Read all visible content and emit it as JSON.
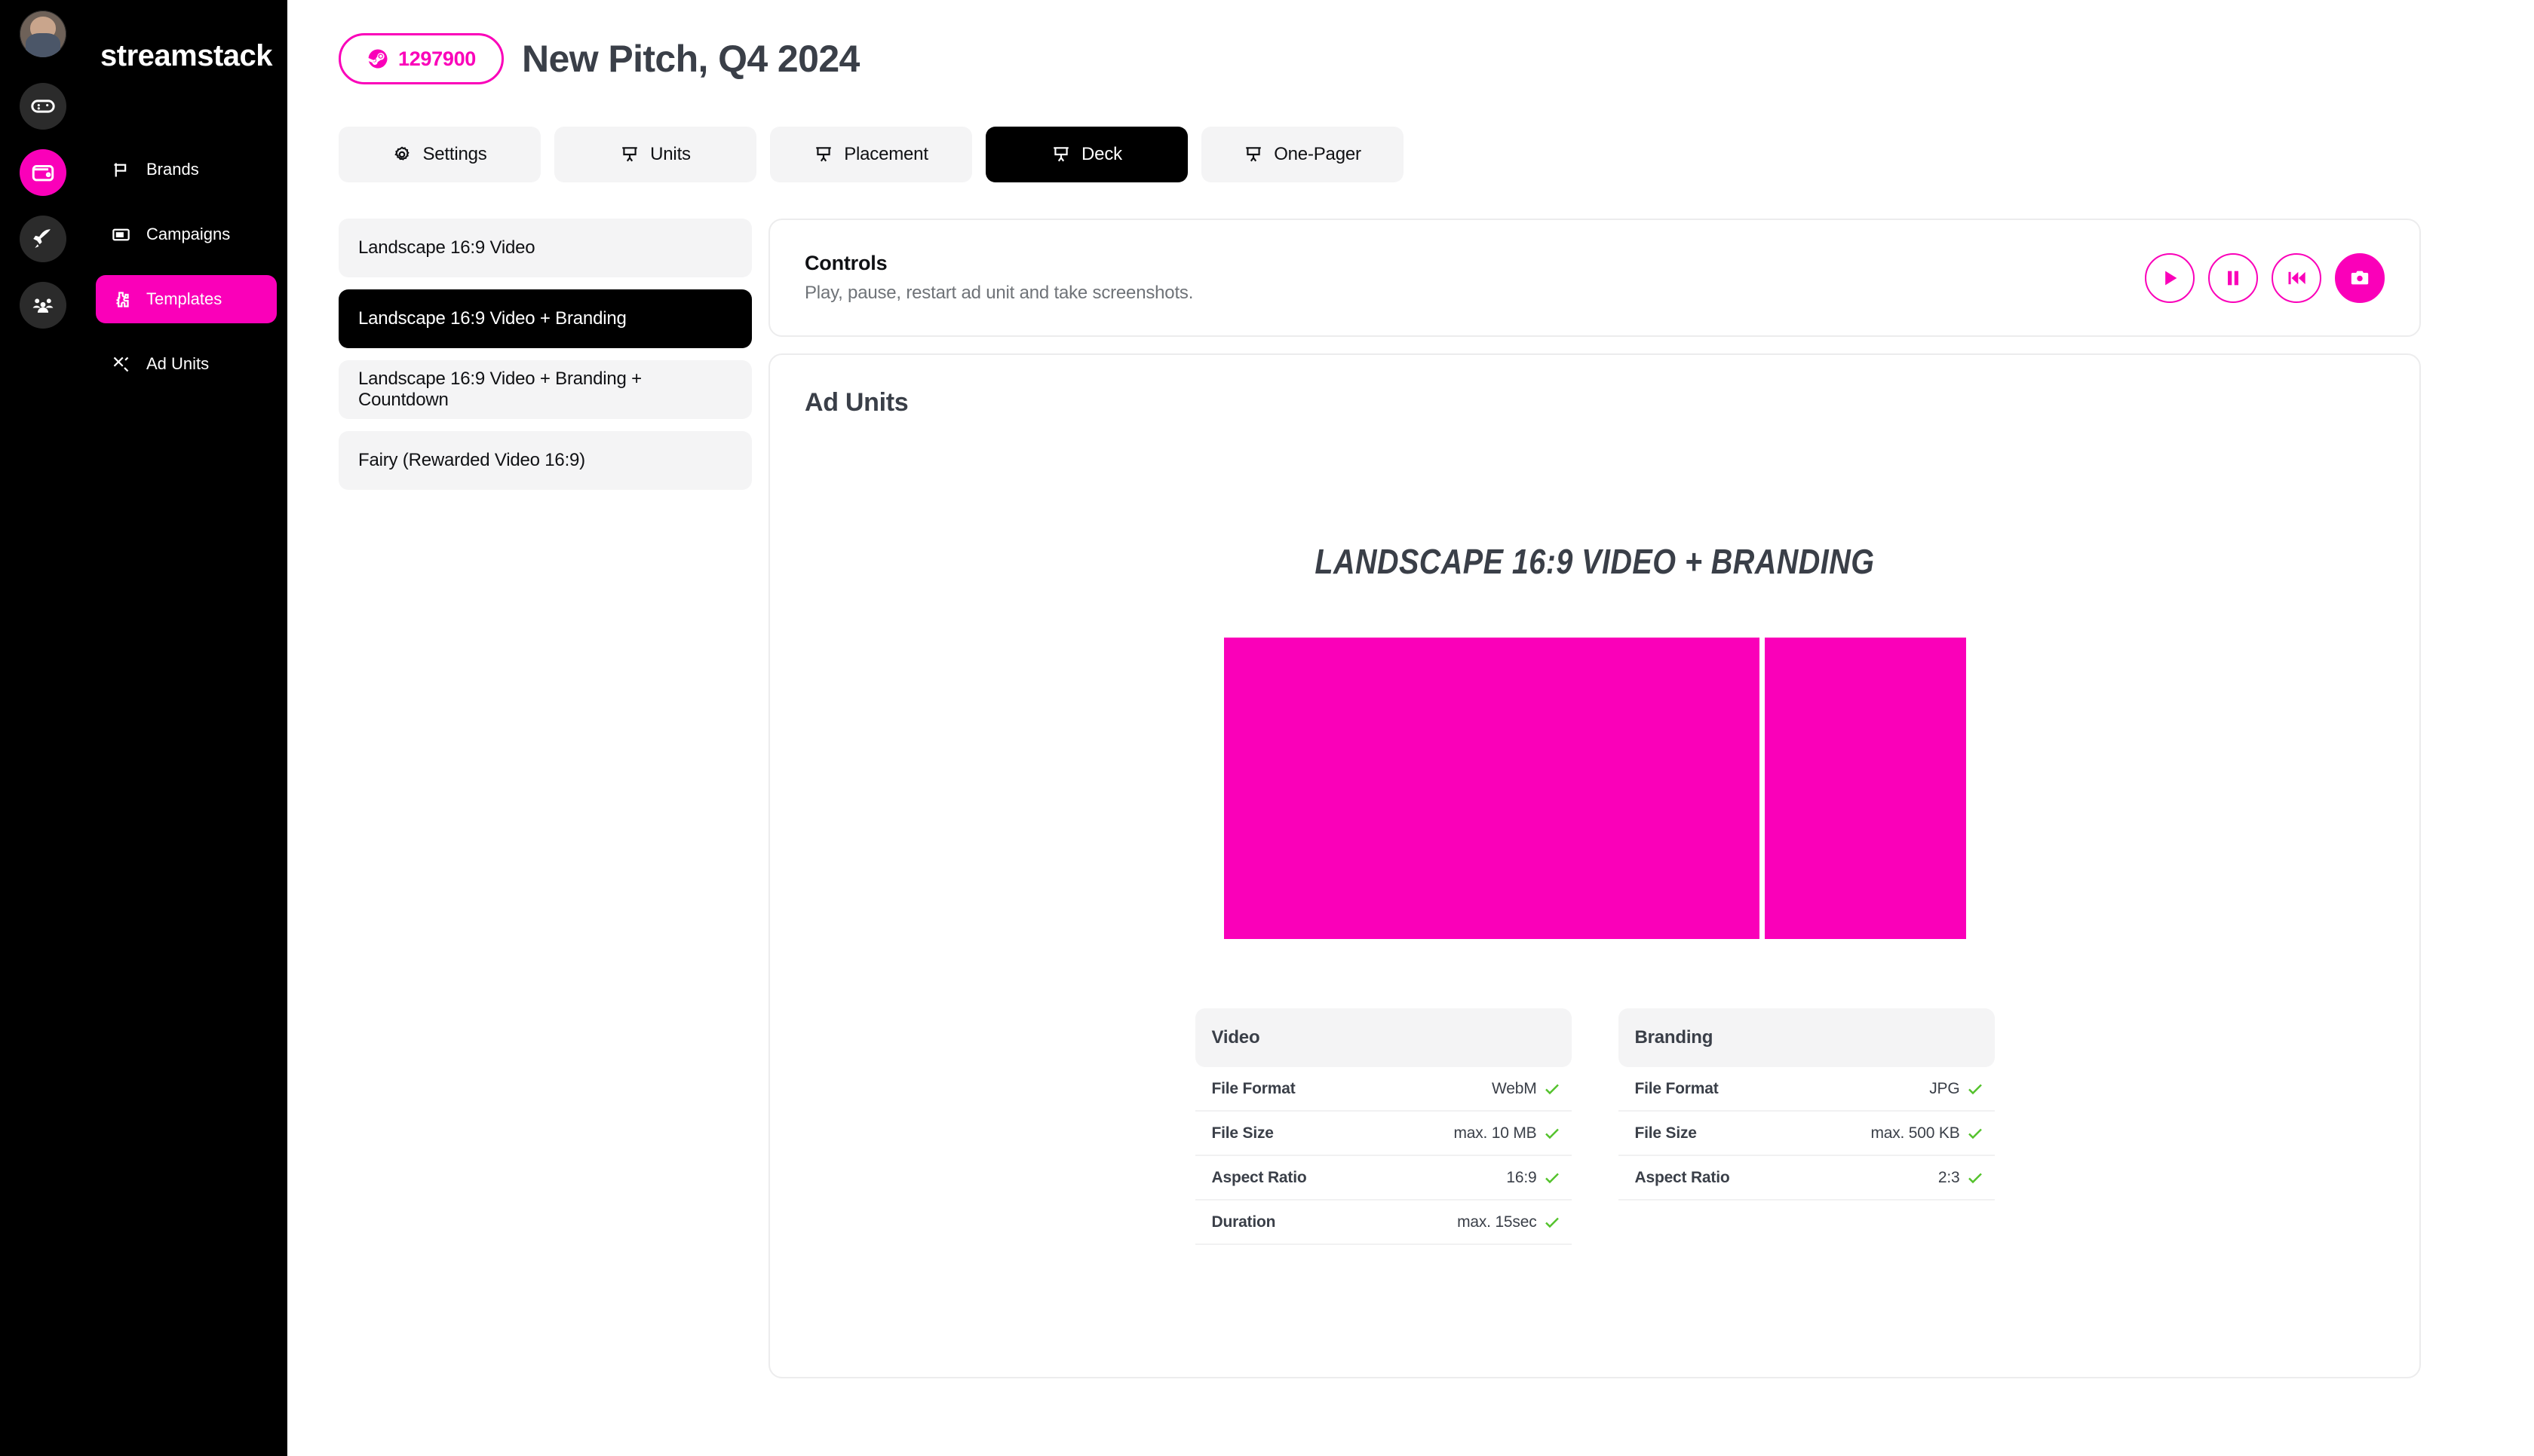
{
  "rail": {
    "avatar_name": "user-avatar",
    "items": [
      {
        "icon": "gamepad-icon",
        "active": false
      },
      {
        "icon": "wallet-icon",
        "active": true
      },
      {
        "icon": "rocket-icon",
        "active": false
      },
      {
        "icon": "team-icon",
        "active": false
      }
    ]
  },
  "sidebar": {
    "brand": "streamstack",
    "items": [
      {
        "label": "Brands",
        "icon": "flag-icon"
      },
      {
        "label": "Campaigns",
        "icon": "slideshow-icon"
      },
      {
        "label": "Templates",
        "icon": "puzzle-icon"
      },
      {
        "label": "Ad Units",
        "icon": "tools-icon"
      }
    ]
  },
  "header": {
    "badge_count": "1297900",
    "badge_icon": "steam-icon",
    "title": "New Pitch, Q4 2024"
  },
  "tabs": [
    {
      "label": "Settings",
      "icon": "gear-icon",
      "active": false
    },
    {
      "label": "Units",
      "icon": "presentation-icon",
      "active": false
    },
    {
      "label": "Placement",
      "icon": "presentation-icon",
      "active": false
    },
    {
      "label": "Deck",
      "icon": "presentation-icon",
      "active": true
    },
    {
      "label": "One-Pager",
      "icon": "presentation-icon",
      "active": false
    }
  ],
  "templates": [
    {
      "label": "Landscape 16:9 Video",
      "active": false
    },
    {
      "label": "Landscape 16:9 Video + Branding",
      "active": true
    },
    {
      "label": "Landscape 16:9 Video + Branding + Countdown",
      "active": false
    },
    {
      "label": "Fairy (Rewarded Video 16:9)",
      "active": false
    }
  ],
  "controls": {
    "title": "Controls",
    "subtitle": "Play, pause, restart ad unit and take screenshots.",
    "buttons": [
      {
        "name": "play-button",
        "icon": "play-icon"
      },
      {
        "name": "pause-button",
        "icon": "pause-icon"
      },
      {
        "name": "restart-button",
        "icon": "rewind-icon"
      },
      {
        "name": "screenshot-button",
        "icon": "camera-icon"
      }
    ]
  },
  "ad_units": {
    "section_title": "Ad Units",
    "preview_title": "Landscape 16:9 Video + Branding",
    "specs": [
      {
        "title": "Video",
        "rows": [
          {
            "key": "File Format",
            "value": "WebM",
            "ok": true
          },
          {
            "key": "File Size",
            "value": "max. 10 MB",
            "ok": true
          },
          {
            "key": "Aspect Ratio",
            "value": "16:9",
            "ok": true
          },
          {
            "key": "Duration",
            "value": "max. 15sec",
            "ok": true
          }
        ]
      },
      {
        "title": "Branding",
        "rows": [
          {
            "key": "File Format",
            "value": "JPG",
            "ok": true
          },
          {
            "key": "File Size",
            "value": "max. 500 KB",
            "ok": true
          },
          {
            "key": "Aspect Ratio",
            "value": "2:3",
            "ok": true
          }
        ]
      }
    ]
  },
  "colors": {
    "accent_pink": "#FA00B9",
    "check_green": "#53c22b",
    "dark": "#000000",
    "panel_grey": "#f4f4f5",
    "text_dark": "#3a3f48"
  }
}
